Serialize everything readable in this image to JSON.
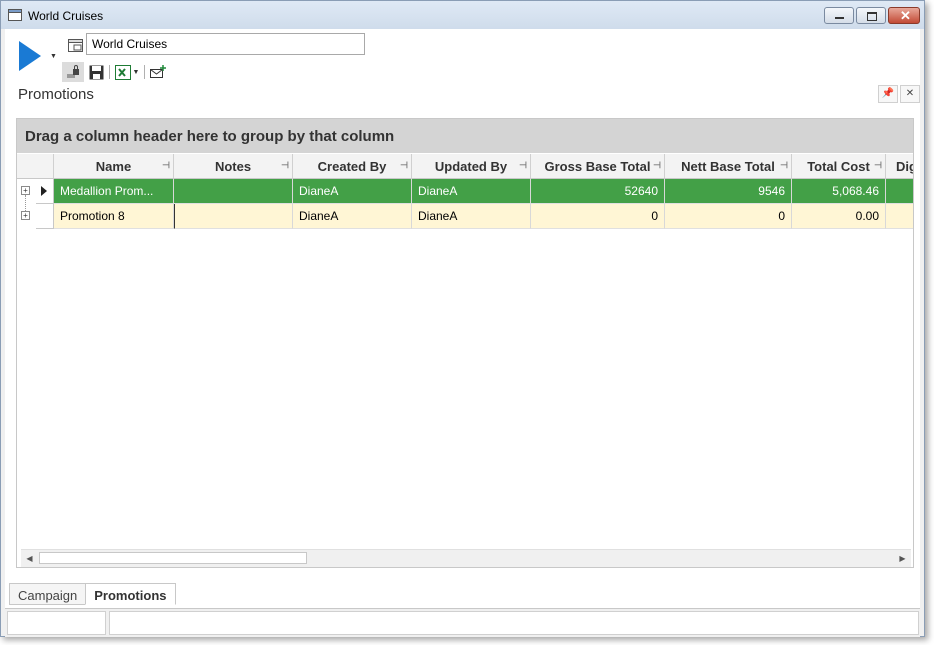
{
  "window": {
    "title": "World Cruises"
  },
  "toolbar": {
    "name_value": "World Cruises"
  },
  "panel": {
    "title": "Promotions"
  },
  "grid": {
    "group_hint": "Drag a column header here to group by that column",
    "columns": [
      "Name",
      "Notes",
      "Created By",
      "Updated By",
      "Gross Base Total",
      "Nett Base Total",
      "Total Cost",
      "Dig"
    ],
    "rows": [
      {
        "name": "Medallion  Prom...",
        "notes": "",
        "created_by": "DianeA",
        "updated_by": "DianeA",
        "gross_base_total": "52640",
        "nett_base_total": "9546",
        "total_cost": "5,068.46",
        "dig": ""
      },
      {
        "name": "Promotion 8",
        "notes": "",
        "created_by": "DianeA",
        "updated_by": "DianeA",
        "gross_base_total": "0",
        "nett_base_total": "0",
        "total_cost": "0.00",
        "dig": ""
      }
    ]
  },
  "tabs": [
    {
      "label": "Campaign",
      "active": false
    },
    {
      "label": "Promotions",
      "active": true
    }
  ],
  "colors": {
    "selected_row": "#43a047",
    "alt_row": "#fff6d5",
    "play_accent": "#1a7ad4"
  },
  "icons": [
    "window-icon",
    "play-icon",
    "name-icon",
    "lock-icon",
    "save-icon",
    "excel-icon",
    "email-icon",
    "pin-icon",
    "close-icon"
  ]
}
